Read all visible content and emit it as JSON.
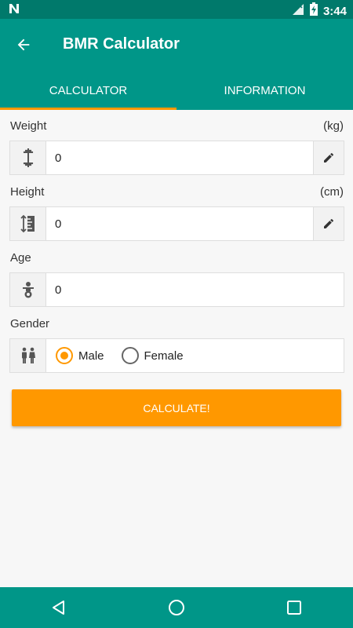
{
  "status_bar": {
    "time": "3:44",
    "icons": [
      "n-notification-icon",
      "wifi-off-icon",
      "signal-icon",
      "battery-charging-icon"
    ]
  },
  "app_bar": {
    "title": "BMR Calculator",
    "back_icon": "arrow-back-icon"
  },
  "tabs": [
    {
      "label": "CALCULATOR",
      "active": true
    },
    {
      "label": "INFORMATION",
      "active": false
    }
  ],
  "form": {
    "weight": {
      "label": "Weight",
      "unit": "(kg)",
      "value": "0",
      "icon": "dumbbell-icon"
    },
    "height": {
      "label": "Height",
      "unit": "(cm)",
      "value": "0",
      "icon": "ruler-height-icon"
    },
    "age": {
      "label": "Age",
      "value": "0",
      "icon": "baby-icon"
    },
    "gender": {
      "label": "Gender",
      "icon": "people-icon",
      "options": [
        {
          "label": "Male",
          "selected": true
        },
        {
          "label": "Female",
          "selected": false
        }
      ]
    }
  },
  "calculate_label": "CALCULATE!",
  "colors": {
    "primary": "#009688",
    "primary_dark": "#00796b",
    "accent": "#ff9800"
  },
  "nav_bar": {
    "icons": [
      "back-triangle-icon",
      "home-circle-icon",
      "recents-square-icon"
    ]
  }
}
